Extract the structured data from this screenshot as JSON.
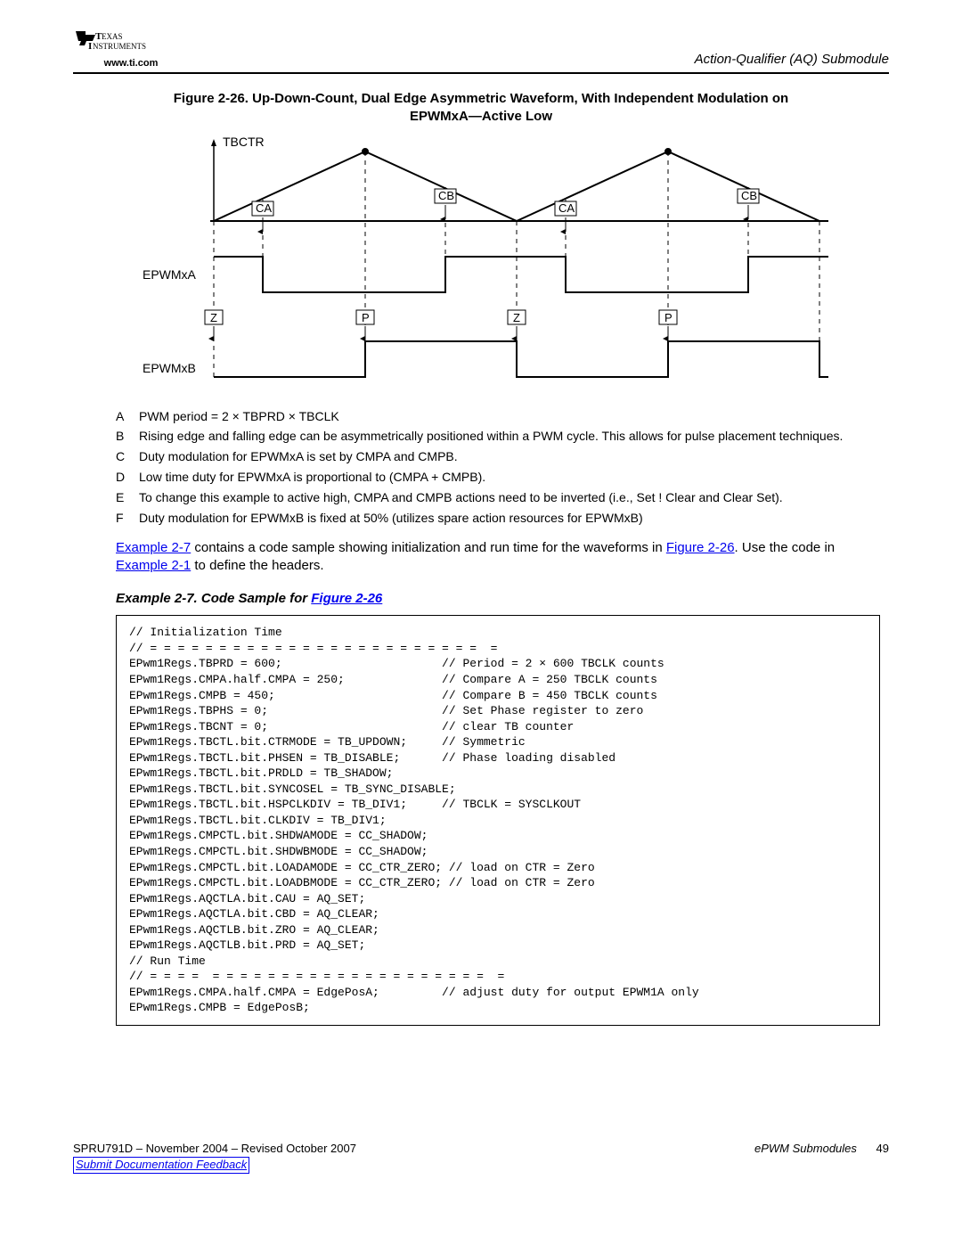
{
  "header": {
    "url": "www.ti.com",
    "section": "Action-Qualifier (AQ) Submodule"
  },
  "figure": {
    "caption_line1": "Figure 2-26. Up-Down-Count, Dual Edge Asymmetric Waveform, With Independent Modulation on",
    "caption_line2": "EPWMxA—Active Low",
    "labels": {
      "tbctr": "TBCTR",
      "epwmxa": "EPWMxA",
      "epwmxb": "EPWMxB",
      "ca": "CA",
      "cb": "CB",
      "z": "Z",
      "p": "P"
    }
  },
  "notes": [
    {
      "tag": "A",
      "text": "PWM period = 2 × TBPRD × TBCLK"
    },
    {
      "tag": "B",
      "text": "Rising edge and falling edge can be asymmetrically positioned within a PWM cycle. This allows for pulse placement techniques."
    },
    {
      "tag": "C",
      "text": "Duty modulation for EPWMxA is set by CMPA and CMPB."
    },
    {
      "tag": "D",
      "text": "Low time duty for EPWMxA is proportional to (CMPA + CMPB)."
    },
    {
      "tag": "E",
      "text": "To change this example to active high, CMPA and CMPB actions need to be inverted (i.e., Set ! Clear and Clear Set)."
    },
    {
      "tag": "F",
      "text": "Duty modulation for EPWMxB is fixed at 50% (utilizes spare action resources for EPWMxB)"
    }
  ],
  "para": {
    "link1": "Example 2-7",
    "mid1": " contains a code sample showing initialization and run time for the waveforms in ",
    "link2": "Figure 2-26",
    "mid2": ". Use the code in ",
    "link3": "Example 2-1",
    "tail": " to define the headers."
  },
  "example": {
    "title_prefix": "Example 2-7. Code Sample for ",
    "title_link": "Figure 2-26"
  },
  "code": "// Initialization Time\n// = = = = = = = = = = = = = = = = = = = = = = = =  =\nEPwm1Regs.TBPRD = 600;                       // Period = 2 × 600 TBCLK counts\nEPwm1Regs.CMPA.half.CMPA = 250;              // Compare A = 250 TBCLK counts\nEPwm1Regs.CMPB = 450;                        // Compare B = 450 TBCLK counts\nEPwm1Regs.TBPHS = 0;                         // Set Phase register to zero\nEPwm1Regs.TBCNT = 0;                         // clear TB counter\nEPwm1Regs.TBCTL.bit.CTRMODE = TB_UPDOWN;     // Symmetric\nEPwm1Regs.TBCTL.bit.PHSEN = TB_DISABLE;      // Phase loading disabled\nEPwm1Regs.TBCTL.bit.PRDLD = TB_SHADOW;\nEPwm1Regs.TBCTL.bit.SYNCOSEL = TB_SYNC_DISABLE;\nEPwm1Regs.TBCTL.bit.HSPCLKDIV = TB_DIV1;     // TBCLK = SYSCLKOUT\nEPwm1Regs.TBCTL.bit.CLKDIV = TB_DIV1;\nEPwm1Regs.CMPCTL.bit.SHDWAMODE = CC_SHADOW;\nEPwm1Regs.CMPCTL.bit.SHDWBMODE = CC_SHADOW;\nEPwm1Regs.CMPCTL.bit.LOADAMODE = CC_CTR_ZERO; // load on CTR = Zero\nEPwm1Regs.CMPCTL.bit.LOADBMODE = CC_CTR_ZERO; // load on CTR = Zero\nEPwm1Regs.AQCTLA.bit.CAU = AQ_SET;\nEPwm1Regs.AQCTLA.bit.CBD = AQ_CLEAR;\nEPwm1Regs.AQCTLB.bit.ZRO = AQ_CLEAR;\nEPwm1Regs.AQCTLB.bit.PRD = AQ_SET;\n// Run Time\n// = = = =  = = = = = = = = = = = = = = = = = = = =  =\nEPwm1Regs.CMPA.half.CMPA = EdgePosA;         // adjust duty for output EPWM1A only\nEPwm1Regs.CMPB = EdgePosB;",
  "footer": {
    "docid": "SPRU791D – November 2004 – Revised October 2007",
    "feedback": "Submit Documentation Feedback",
    "chapter": "ePWM Submodules",
    "page": "49"
  },
  "chart_data": {
    "type": "diagram",
    "description": "Three stacked timing diagrams sharing the same horizontal time axis over two PWM periods.",
    "signals": [
      {
        "name": "TBCTR",
        "kind": "triangle",
        "events_per_period": [
          {
            "label": "CA",
            "edge": "up-count compare",
            "arrow": "up"
          },
          {
            "label": "CB",
            "edge": "down-count compare",
            "arrow": "down"
          }
        ],
        "periods_shown": 2
      },
      {
        "name": "EPWMxA",
        "kind": "digital",
        "initial": "high",
        "events_per_period": [
          {
            "at": "CA (up)",
            "action": "go low"
          },
          {
            "at": "CB (down)",
            "action": "go high"
          }
        ]
      },
      {
        "name": "EPWMxB",
        "kind": "digital",
        "initial": "low",
        "events_per_period": [
          {
            "label": "Z",
            "at": "zero",
            "arrow": "down",
            "action": "go low"
          },
          {
            "label": "P",
            "at": "period",
            "arrow": "up",
            "action": "go high"
          }
        ]
      }
    ]
  }
}
